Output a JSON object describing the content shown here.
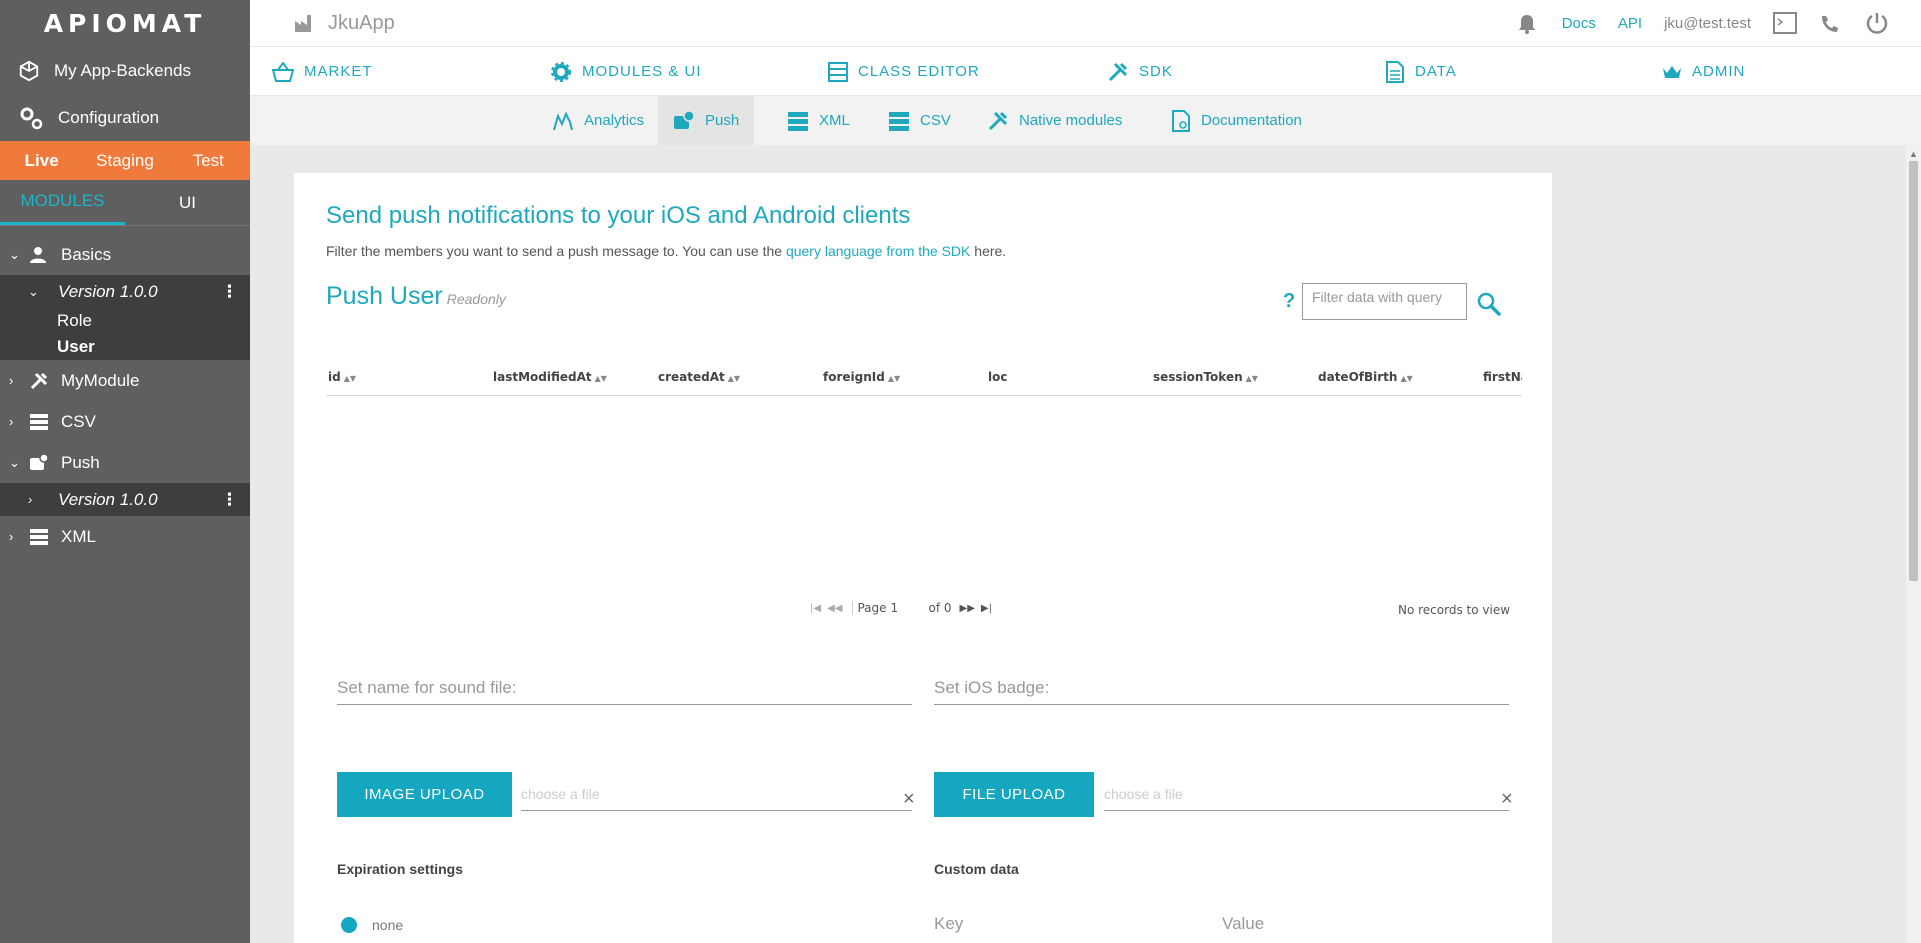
{
  "logo": "ApiOMat",
  "sidebar": {
    "nav": [
      {
        "label": "My App-Backends",
        "icon": "cube-icon"
      },
      {
        "label": "Configuration",
        "icon": "gears-icon"
      }
    ],
    "environments": [
      {
        "label": "Live",
        "active": true
      },
      {
        "label": "Staging",
        "active": false
      },
      {
        "label": "Test",
        "active": false
      }
    ],
    "module_tabs": [
      {
        "label": "MODULES",
        "active": true
      },
      {
        "label": "UI",
        "active": false
      }
    ],
    "tree": {
      "basics": "Basics",
      "basics_version": "Version 1.0.0",
      "role": "Role",
      "user": "User",
      "mymodule": "MyModule",
      "csv": "CSV",
      "push": "Push",
      "push_version": "Version 1.0.0",
      "xml": "XML"
    }
  },
  "topbar": {
    "app_name": "JkuApp",
    "docs": "Docs",
    "api": "API",
    "user": "jku@test.test"
  },
  "main_nav": [
    {
      "label": "MARKET",
      "icon": "basket-icon"
    },
    {
      "label": "MODULES & UI",
      "icon": "gear-icon"
    },
    {
      "label": "CLASS EDITOR",
      "icon": "class-editor-icon"
    },
    {
      "label": "SDK",
      "icon": "tools-icon"
    },
    {
      "label": "DATA",
      "icon": "document-icon"
    },
    {
      "label": "ADMIN",
      "icon": "crown-icon"
    }
  ],
  "sub_nav": [
    {
      "label": "Analytics",
      "icon": "analytics-icon"
    },
    {
      "label": "Push",
      "icon": "push-icon",
      "active": true
    },
    {
      "label": "XML",
      "icon": "xml-icon"
    },
    {
      "label": "CSV",
      "icon": "csv-icon"
    },
    {
      "label": "Native modules",
      "icon": "tools-icon"
    },
    {
      "label": "Documentation",
      "icon": "documentation-icon"
    }
  ],
  "content": {
    "heading": "Send push notifications to your iOS and Android clients",
    "desc_before": "Filter the members you want to send a push message to. You can use the ",
    "desc_link": "query language from the SDK",
    "desc_after": " here.",
    "table_title": "Push User",
    "readonly": "Readonly",
    "help": "?",
    "filter_placeholder": "Filter data with query",
    "columns": [
      "id",
      "lastModifiedAt",
      "createdAt",
      "foreignId",
      "loc",
      "sessionToken",
      "dateOfBirth",
      "firstNa"
    ],
    "pager": {
      "page_label": "Page",
      "page": "1",
      "of": "of 0"
    },
    "no_records": "No records to view",
    "sound_placeholder": "Set name for sound file:",
    "badge_placeholder": "Set iOS badge:",
    "image_upload": "IMAGE UPLOAD",
    "file_upload": "FILE UPLOAD",
    "choose_file": "choose a file",
    "clear": "×",
    "expiration_label": "Expiration settings",
    "custom_data_label": "Custom data",
    "radio_none": "none",
    "key_placeholder": "Key",
    "value_placeholder": "Value"
  }
}
